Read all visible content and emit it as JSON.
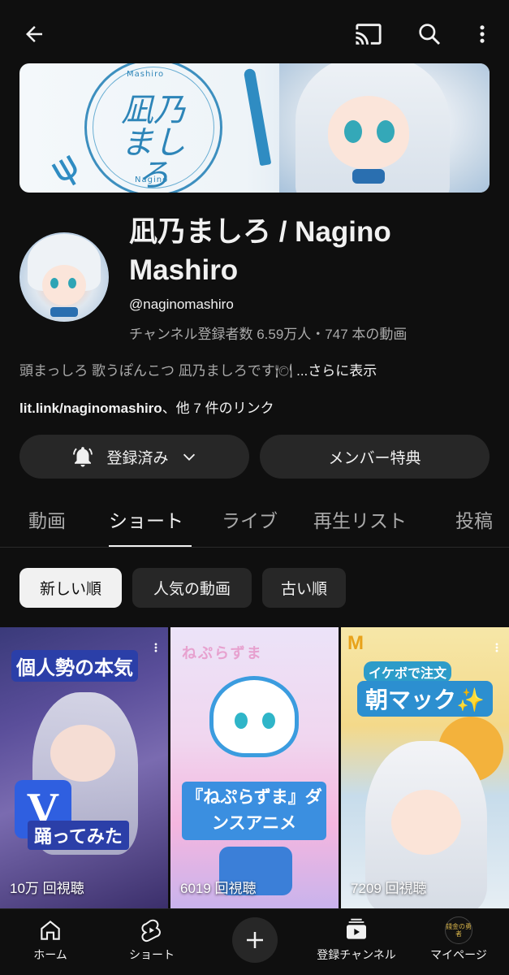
{
  "topbar": {
    "back_icon": "arrow-left-icon",
    "cast_icon": "cast-icon",
    "search_icon": "search-icon",
    "more_icon": "more-vertical-icon"
  },
  "banner": {
    "logo_text_jp": "凪乃ましろ",
    "logo_text_top": "Mashiro",
    "logo_text_bottom": "Nagino"
  },
  "channel": {
    "name": "凪乃ましろ / Nagino Mashiro",
    "handle": "@naginomashiro",
    "stats": "チャンネル登録者数 6.59万人・747 本の動画",
    "description": "頭まっしろ 歌うぽんこつ 凪乃ましろです🍽",
    "description_more": "...さらに表示",
    "link_url": "lit.link/naginomashiro",
    "link_suffix": "、他 7 件のリンク"
  },
  "buttons": {
    "subscribed": "登録済み",
    "member": "メンバー特典"
  },
  "tabs": [
    "動画",
    "ショート",
    "ライブ",
    "再生リスト",
    "投稿"
  ],
  "active_tab": "ショート",
  "chips": [
    "新しい順",
    "人気の動画",
    "古い順"
  ],
  "active_chip": "新しい順",
  "shorts": [
    {
      "caption": "個人勢の本気",
      "badge": "V",
      "caption2": "踊ってみた",
      "views": "10万 回視聴"
    },
    {
      "title_art": "ねぷらずま",
      "caption": "『ねぷらずま』ダンスアニメ",
      "views": "6019 回視聴"
    },
    {
      "brand": "M",
      "sub": "イケボで注文",
      "caption": "朝マック✨",
      "views": "7209 回視聴"
    }
  ],
  "bottom_nav": {
    "home": "ホーム",
    "shorts": "ショート",
    "create_icon": "plus-icon",
    "subscriptions": "登録チャンネル",
    "mypage": "マイページ",
    "mypage_avatar_text": "錢金の勇者"
  },
  "colors": {
    "background": "#0f0f0f",
    "button_bg": "#272727",
    "text_primary": "#f1f1f1",
    "text_secondary": "#aaaaaa"
  }
}
